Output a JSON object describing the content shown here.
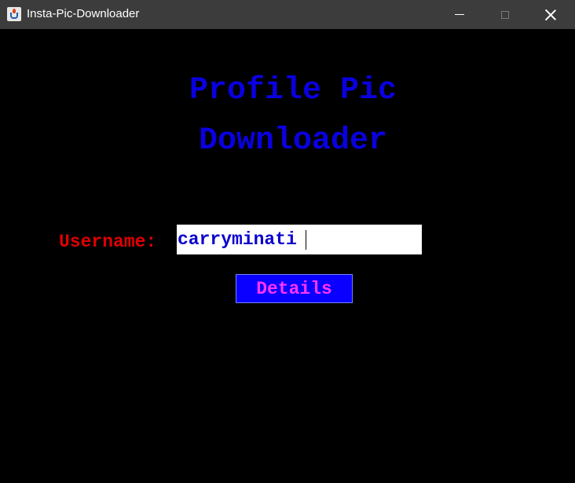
{
  "window": {
    "title": "Insta-Pic-Downloader"
  },
  "main": {
    "heading_line1": "Profile Pic",
    "heading_line2": "Downloader",
    "username_label": "Username:",
    "username_value": "carryminati",
    "details_button": "Details"
  },
  "colors": {
    "background": "#000000",
    "heading": "#0a00e0",
    "label": "#e00000",
    "input_text": "#0a00cc",
    "button_bg": "#0a00ff",
    "button_text": "#ff33ff"
  }
}
